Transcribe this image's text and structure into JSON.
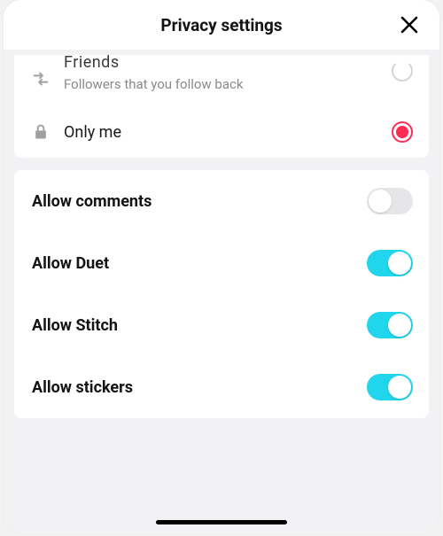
{
  "header": {
    "title": "Privacy settings"
  },
  "audience": {
    "friends": {
      "label": "Friends",
      "sub": "Followers that you follow back"
    },
    "only_me": {
      "label": "Only me"
    }
  },
  "toggles": {
    "comments": {
      "label": "Allow comments",
      "on": false
    },
    "duet": {
      "label": "Allow Duet",
      "on": true
    },
    "stitch": {
      "label": "Allow Stitch",
      "on": true
    },
    "stickers": {
      "label": "Allow stickers",
      "on": true
    }
  }
}
